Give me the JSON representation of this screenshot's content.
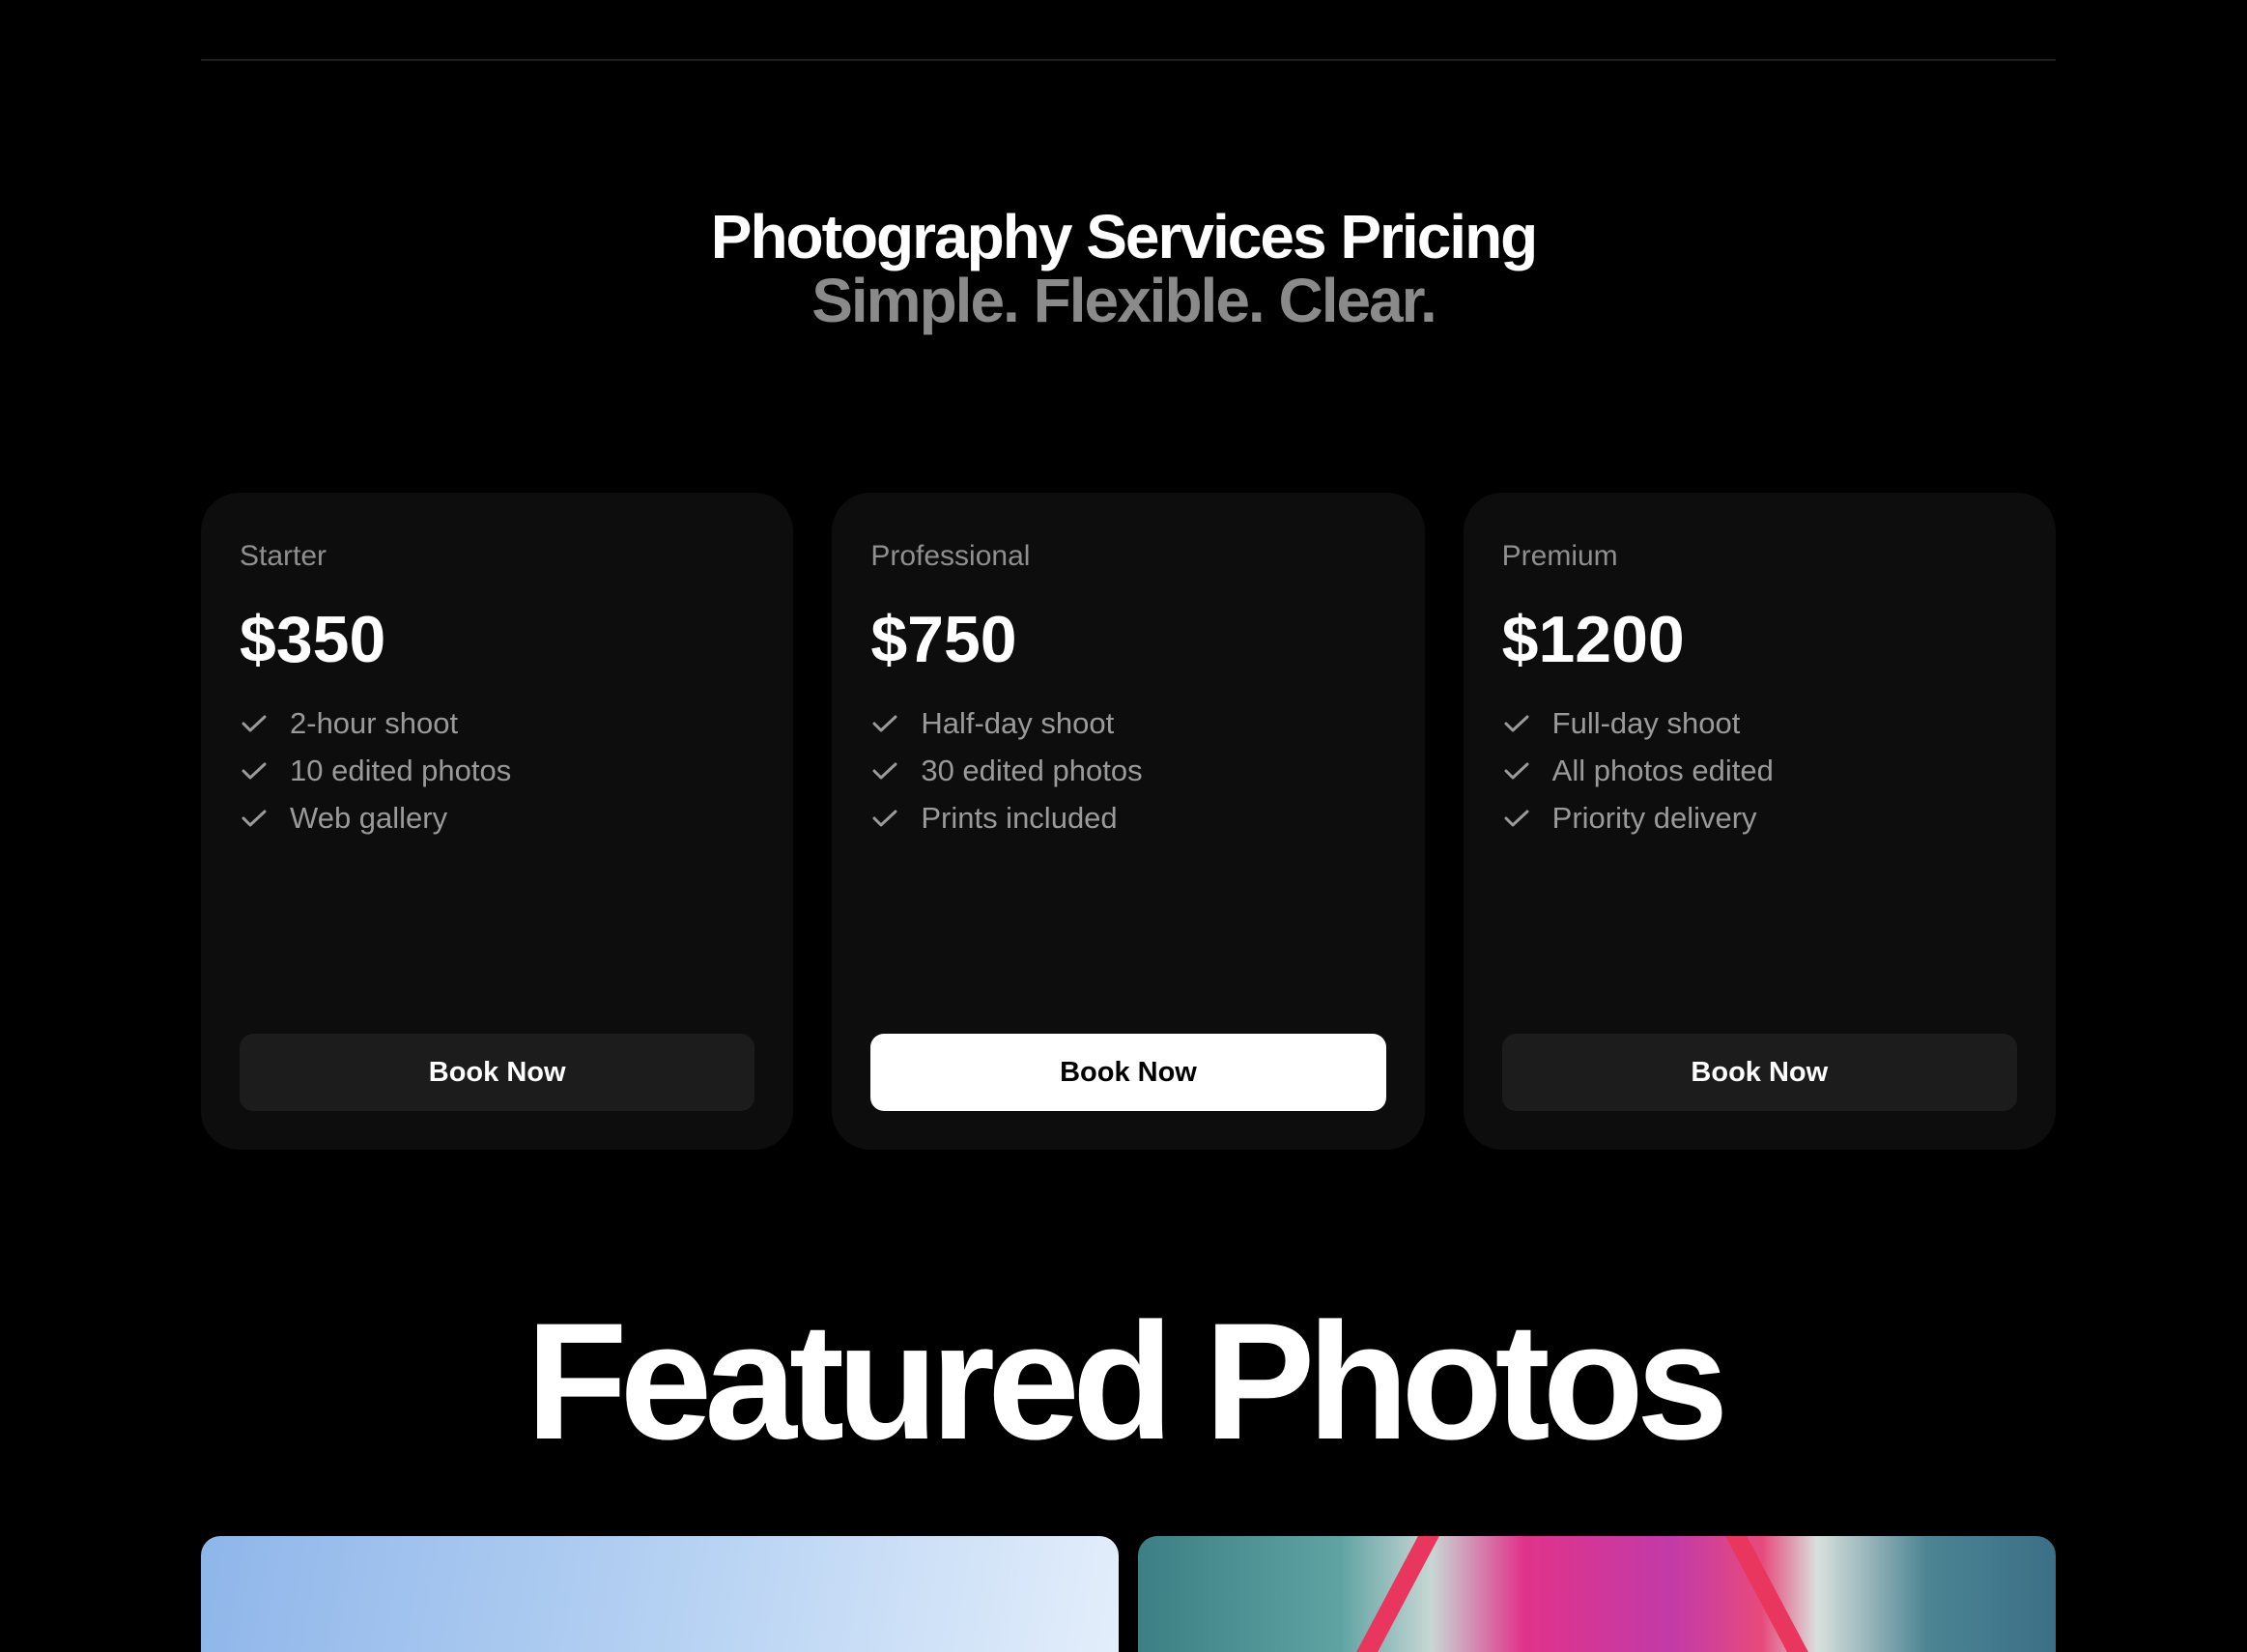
{
  "pricing": {
    "title": "Photography Services Pricing",
    "subtitle": "Simple. Flexible. Clear.",
    "plans": [
      {
        "name": "Starter",
        "price": "$350",
        "features": [
          "2-hour shoot",
          "10 edited photos",
          "Web gallery"
        ],
        "button_label": "Book Now",
        "highlighted": false
      },
      {
        "name": "Professional",
        "price": "$750",
        "features": [
          "Half-day shoot",
          "30 edited photos",
          "Prints included"
        ],
        "button_label": "Book Now",
        "highlighted": true
      },
      {
        "name": "Premium",
        "price": "$1200",
        "features": [
          "Full-day shoot",
          "All photos edited",
          "Priority delivery"
        ],
        "button_label": "Book Now",
        "highlighted": false
      }
    ]
  },
  "featured": {
    "title": "Featured Photos"
  },
  "icons": {
    "feature_check": "check-icon"
  },
  "colors": {
    "background": "#000000",
    "card": "#0d0d0d",
    "muted_text": "#8a8a8a",
    "button_dark": "#1c1c1c",
    "button_light": "#ffffff"
  }
}
